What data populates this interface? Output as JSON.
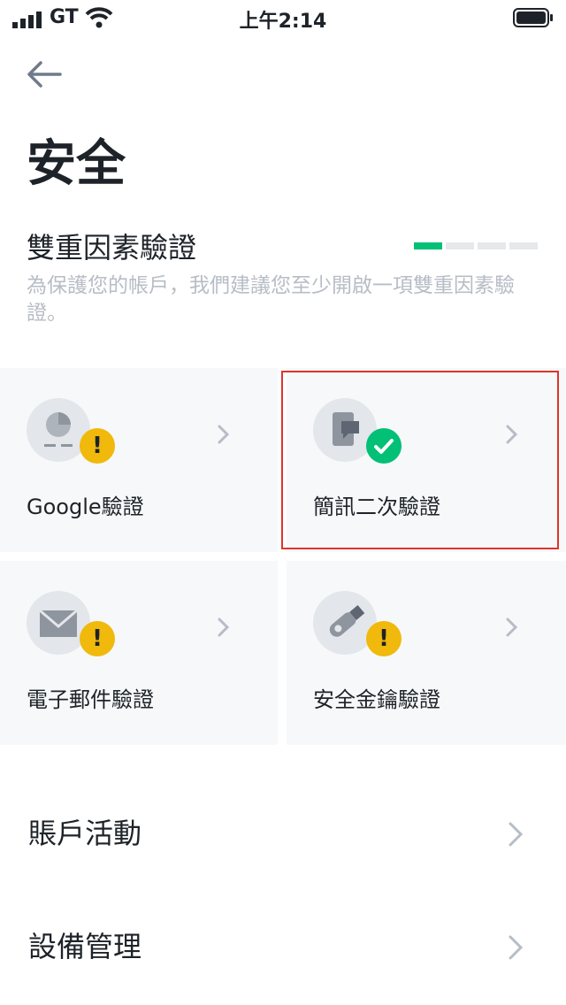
{
  "status_bar": {
    "carrier": "GT",
    "time": "上午2:14"
  },
  "header": {
    "title": "安全"
  },
  "two_factor": {
    "title": "雙重因素驗證",
    "description": "為保護您的帳戶，我們建議您至少開啟一項雙重因素驗證。",
    "progress": {
      "completed": 1,
      "total": 4
    },
    "colors": {
      "accent": "#02c076",
      "warning": "#f0b90b",
      "track": "#e6e8ea"
    }
  },
  "methods": [
    {
      "label": "Google驗證",
      "icon": "google-authenticator-icon",
      "status": "warning",
      "badge": "!"
    },
    {
      "label": "簡訊二次驗證",
      "icon": "sms-icon",
      "status": "enabled",
      "badge": "✓"
    },
    {
      "label": "電子郵件驗證",
      "icon": "email-icon",
      "status": "warning",
      "badge": "!"
    },
    {
      "label": "安全金鑰驗證",
      "icon": "security-key-icon",
      "status": "warning",
      "badge": "!"
    }
  ],
  "list": [
    {
      "label": "賬戶活動"
    },
    {
      "label": "設備管理"
    }
  ]
}
